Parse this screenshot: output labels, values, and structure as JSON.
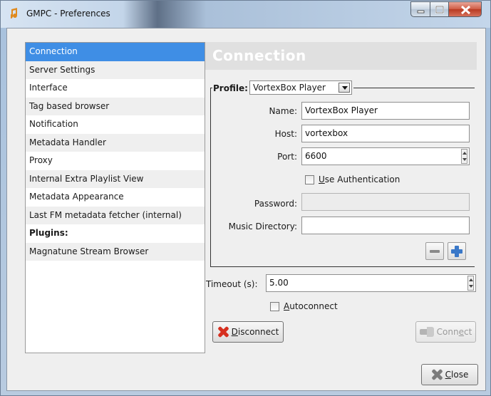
{
  "window": {
    "title": "GMPC - Preferences"
  },
  "sidebar": {
    "items": [
      {
        "label": "Connection",
        "state": "selected"
      },
      {
        "label": "Server Settings"
      },
      {
        "label": "Interface"
      },
      {
        "label": "Tag based browser"
      },
      {
        "label": "Notification"
      },
      {
        "label": "Metadata Handler"
      },
      {
        "label": "Proxy"
      },
      {
        "label": "Internal Extra Playlist View"
      },
      {
        "label": "Metadata Appearance"
      },
      {
        "label": "Last FM metadata fetcher (internal)"
      },
      {
        "label": "Plugins:",
        "style": "bold"
      },
      {
        "label": "Magnatune Stream Browser"
      }
    ]
  },
  "panel": {
    "title": "Connection",
    "profile_label": "Profile:",
    "profile_value": "VortexBox Player",
    "name_label": "Name:",
    "name_value": "VortexBox Player",
    "host_label": "Host:",
    "host_value": "vortexbox",
    "port_label": "Port:",
    "port_value": "6600",
    "use_auth_prefix": "",
    "use_auth_mnemonic": "U",
    "use_auth_rest": "se Authentication",
    "password_label": "Password:",
    "password_value": "",
    "music_dir_label": "Music Directory:",
    "music_dir_value": "",
    "timeout_label": "Timeout (s):",
    "timeout_value": "5.00",
    "autoconnect_mnemonic": "A",
    "autoconnect_rest": "utoconnect",
    "disconnect_mnemonic": "D",
    "disconnect_rest": "isconnect",
    "connect_prefix": "Conn",
    "connect_mnemonic": "e",
    "connect_rest": "ct"
  },
  "footer": {
    "close_mnemonic": "C",
    "close_rest": "lose"
  },
  "colors": {
    "selection": "#3f8ee5",
    "plus_icon": "#3a78c8",
    "disconnect_icon": "#d62f1f"
  }
}
